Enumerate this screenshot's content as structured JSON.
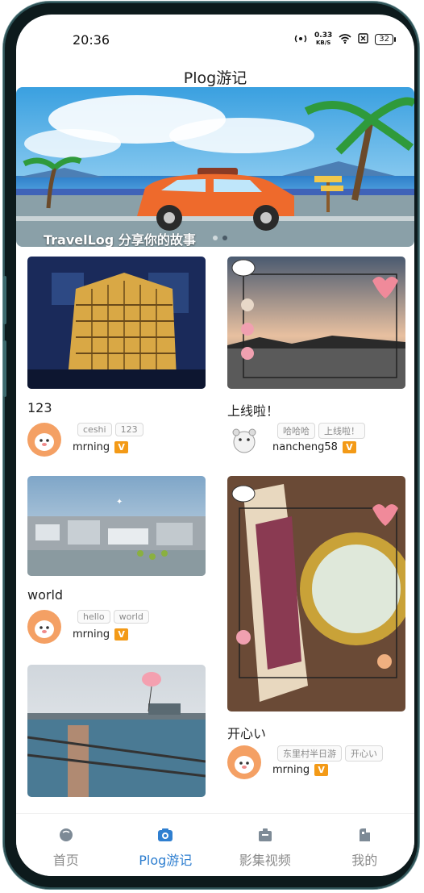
{
  "status_bar": {
    "time": "20:36",
    "speed_value": "0.33",
    "speed_unit": "KB/S",
    "battery": "32"
  },
  "header": {
    "title": "Plog游记"
  },
  "banner": {
    "caption": "TravelLog 分享你的故事",
    "dot_count": 2,
    "active_dot": 2
  },
  "posts": [
    {
      "title": "123",
      "tags": [
        "ceshi",
        "123"
      ],
      "username": "mrning",
      "vip_label": "V"
    },
    {
      "title": "上线啦！",
      "tags": [
        "哈哈哈",
        "上线啦！"
      ],
      "username": "nancheng58",
      "vip_label": "V"
    },
    {
      "title": "world",
      "tags": [
        "hello",
        "world"
      ],
      "username": "mrning",
      "vip_label": "V"
    },
    {
      "title": "开心い",
      "tags": [
        "东里村半日游",
        "开心い"
      ],
      "username": "mrning",
      "vip_label": "V"
    },
    {
      "title": "",
      "tags": [],
      "username": "",
      "vip_label": ""
    }
  ],
  "tabbar": {
    "items": [
      {
        "label": "首页",
        "icon": "home-icon",
        "active": false
      },
      {
        "label": "Plog游记",
        "icon": "camera-icon",
        "active": true
      },
      {
        "label": "影集视频",
        "icon": "video-icon",
        "active": false
      },
      {
        "label": "我的",
        "icon": "user-icon",
        "active": false
      }
    ]
  },
  "colors": {
    "accent": "#2f7fd0",
    "vip": "#f39a17",
    "tab_inactive": "#8a8a8a"
  }
}
